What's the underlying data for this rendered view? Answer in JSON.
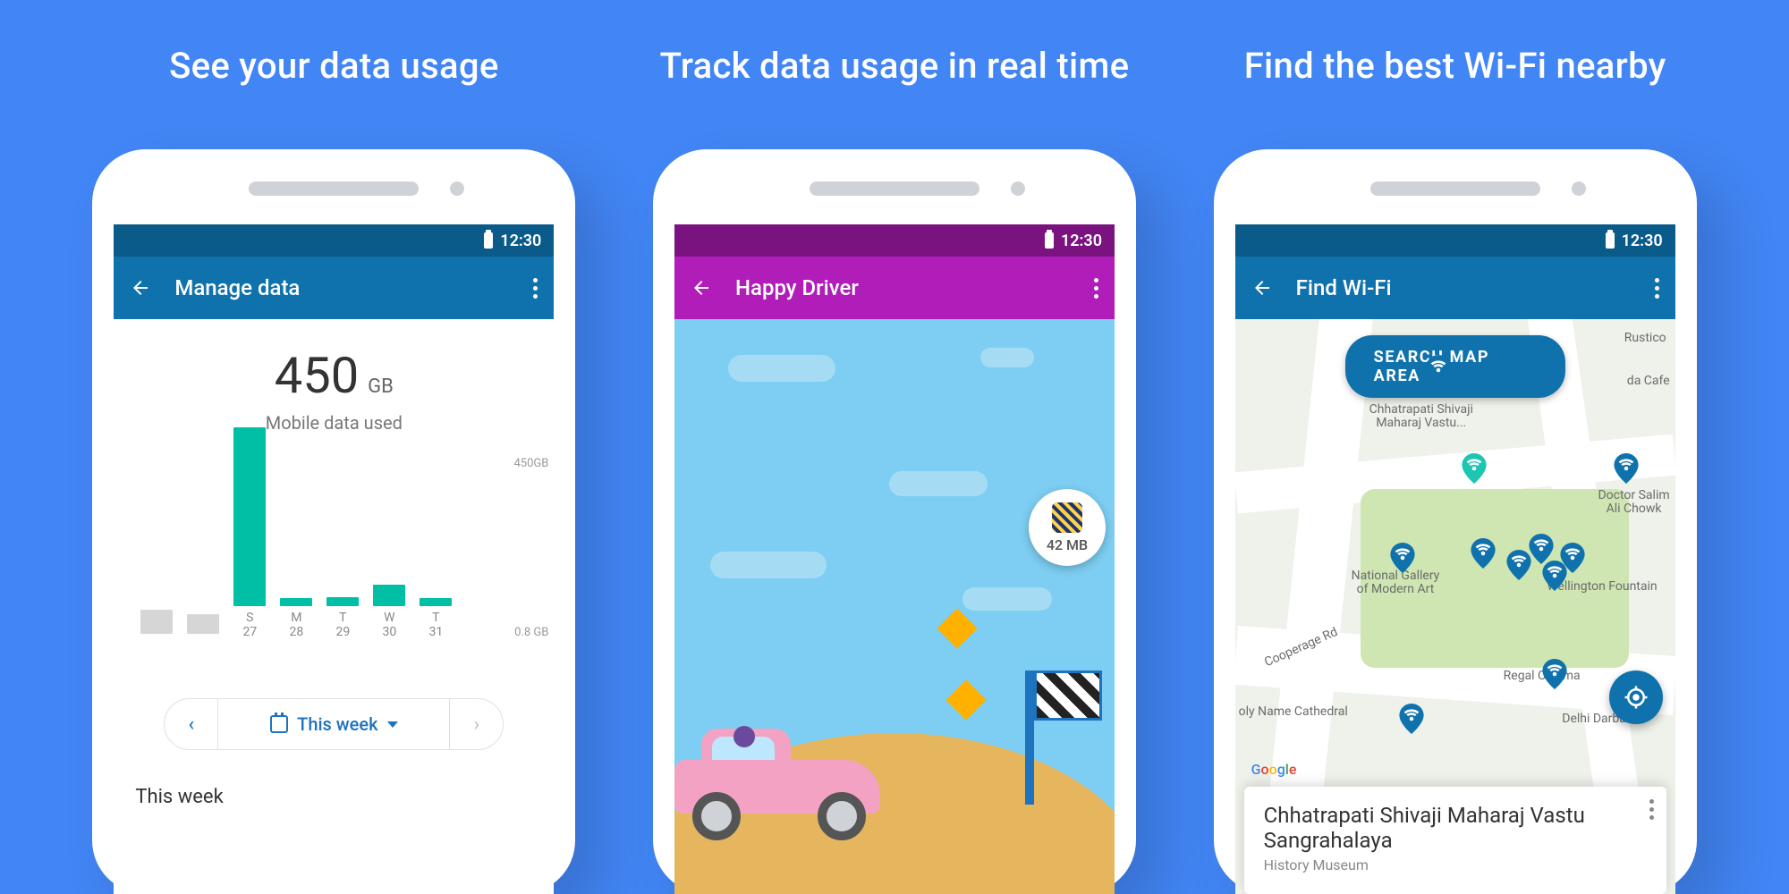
{
  "titles": {
    "s1": "See your data usage",
    "s2": "Track data usage in real time",
    "s3": "Find the best Wi-Fi nearby"
  },
  "status_time": "12:30",
  "screens": {
    "s1": {
      "appbar_title": "Manage data",
      "total_value": "450",
      "total_unit": "GB",
      "total_label": "Mobile data used",
      "yticks": {
        "top": "450GB",
        "bottom": "0.8 GB"
      },
      "range_label": "This week",
      "section_header": "This week"
    },
    "s2": {
      "appbar_title": "Happy Driver",
      "badge_value": "42 MB"
    },
    "s3": {
      "appbar_title": "Find Wi-Fi",
      "pill_label": "SEARCH MAP AREA",
      "map_labels": {
        "rustico": "Rustico",
        "cafe": "da Cafe",
        "chhatrapati": "Chhatrapati Shivaji\nMaharaj Vastu...",
        "salim": "Doctor Salim\nAli Chowk",
        "gallery": "National Gallery\nof Modern Art",
        "wellington": "Wellington Fountain",
        "regal": "Regal Cinema",
        "cathedral": "oly Name Cathedral",
        "delhi": "Delhi Darbar",
        "colaba": "Cooperage Rd"
      },
      "card_title": "Chhatrapati Shivaji Maharaj Vastu Sangrahalaya",
      "card_sub": "History Museum",
      "attribution": "Google"
    }
  },
  "chart_data": {
    "type": "bar",
    "title": "Mobile data used",
    "ylabel": "",
    "ylim": [
      0,
      450
    ],
    "ytick_labels": [
      "450GB",
      "0.8 GB"
    ],
    "categories_top": [
      "",
      "",
      "S",
      "M",
      "T",
      "W",
      "T"
    ],
    "categories_bottom": [
      "",
      "",
      "27",
      "28",
      "29",
      "30",
      "31"
    ],
    "series": [
      {
        "name": "previous-cycle",
        "color": "#d6d6d6",
        "values": [
          60,
          50,
          null,
          null,
          null,
          null,
          null
        ]
      },
      {
        "name": "this-week",
        "color": "#00bfa5",
        "values": [
          null,
          null,
          450,
          20,
          22,
          55,
          20
        ]
      }
    ]
  }
}
